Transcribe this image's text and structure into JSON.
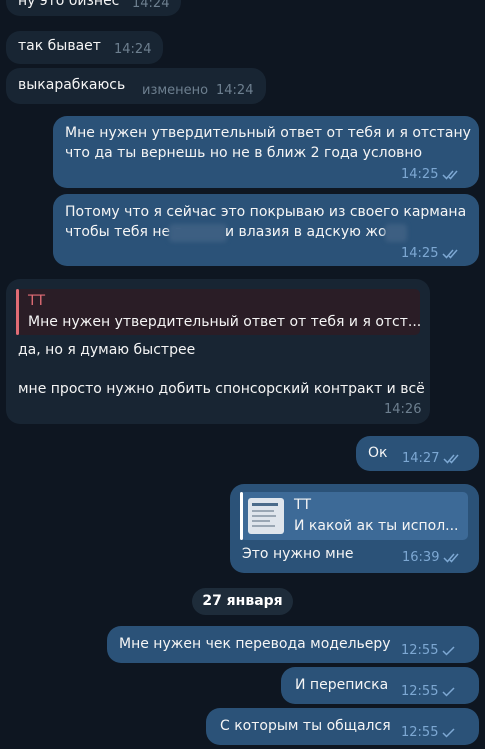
{
  "chat": {
    "date_separator": "27 января",
    "messages": [
      {
        "text": "ну это бизнес",
        "time": "14:24"
      },
      {
        "text": "так бывает",
        "time": "14:24"
      },
      {
        "text": "выкарабкаюсь",
        "edited_label": "изменено",
        "time": "14:24"
      },
      {
        "lines": [
          "Мне нужен утвердительный ответ от тебя и я отстану",
          "что да ты вернешь но не в ближ 2 года условно"
        ],
        "time": "14:25",
        "status": "read"
      },
      {
        "lines": [
          "Потому что я сейчас это покрываю из своего кармана",
          "чтобы тебя не в",
          "и влазия в адскую жо"
        ],
        "time": "14:25",
        "status": "read"
      },
      {
        "reply_author": "ТТ",
        "reply_text": "Мне нужен утвердительный ответ от тебя и я отст...",
        "lines": [
          "да, но я думаю быстрее",
          "мне просто нужно добить спонсорский контракт и всё"
        ],
        "time": "14:26"
      },
      {
        "text": "Ок",
        "time": "14:27",
        "status": "read"
      },
      {
        "reply_author": "ТТ",
        "reply_text": "И какой ак ты испол...",
        "text": "Это нужно мне",
        "time": "16:39",
        "status": "read"
      },
      {
        "text": "Мне нужен чек перевода модельеру",
        "time": "12:55",
        "status": "sent"
      },
      {
        "text": "И переписка",
        "time": "12:55",
        "status": "sent"
      },
      {
        "text": "С которым ты общался",
        "time": "12:55",
        "status": "sent"
      }
    ]
  },
  "colors": {
    "background": "#0e1621",
    "incoming_bubble": "#182533",
    "outgoing_bubble": "#2b5278",
    "reply_accent": "#e06c75",
    "reply_accent_out": "#ffffff"
  },
  "icons": {
    "read_status": "double-check-icon",
    "sent_status": "single-check-icon",
    "reply_thumbnail": "image-thumbnail-icon"
  }
}
